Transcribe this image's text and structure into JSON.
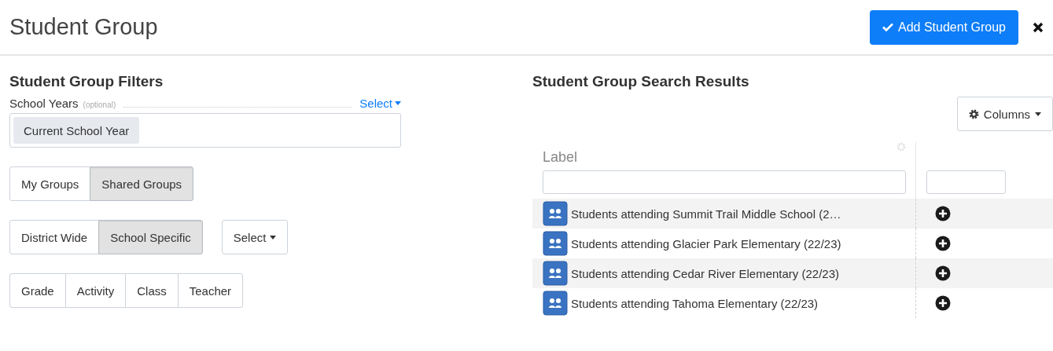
{
  "header": {
    "title": "Student Group",
    "add_button": "Add Student Group"
  },
  "filters": {
    "heading": "Student Group Filters",
    "school_years": {
      "label": "School Years",
      "hint": "(optional)",
      "select": "Select",
      "tags": [
        "Current School Year"
      ]
    },
    "ownership": [
      {
        "label": "My Groups",
        "selected": false
      },
      {
        "label": "Shared Groups",
        "selected": true
      }
    ],
    "scope": [
      {
        "label": "District Wide",
        "selected": false
      },
      {
        "label": "School Specific",
        "selected": true
      }
    ],
    "scope_select": "Select",
    "types": [
      {
        "label": "Grade",
        "selected": false
      },
      {
        "label": "Activity",
        "selected": false
      },
      {
        "label": "Class",
        "selected": false
      },
      {
        "label": "Teacher",
        "selected": false
      }
    ]
  },
  "results": {
    "heading": "Student Group Search Results",
    "columns_button": "Columns",
    "table": {
      "columns": [
        {
          "label": "Label"
        },
        {}
      ],
      "rows": [
        {
          "label": "Students attending Summit Trail Middle School (2…"
        },
        {
          "label": "Students attending Glacier Park Elementary (22/23)"
        },
        {
          "label": "Students attending Cedar River Elementary (22/23)"
        },
        {
          "label": "Students attending Tahoma Elementary (22/23)"
        }
      ]
    }
  }
}
